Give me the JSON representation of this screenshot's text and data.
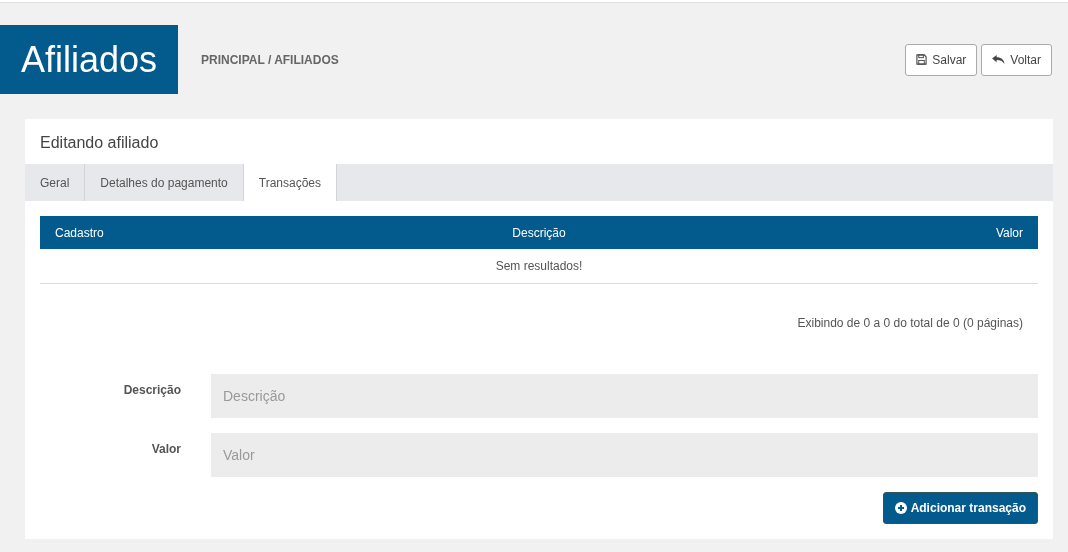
{
  "page_title": "Afiliados",
  "breadcrumb": {
    "items": [
      {
        "label": "PRINCIPAL"
      },
      {
        "label": "AFILIADOS"
      }
    ],
    "separator": "/"
  },
  "header_buttons": [
    {
      "label": "Salvar",
      "kind": "save"
    },
    {
      "label": "Voltar",
      "kind": "back"
    }
  ],
  "card_title": "Editando afiliado",
  "tabs": [
    {
      "label": "Geral",
      "selected": false
    },
    {
      "label": "Detalhes do pagamento",
      "selected": false
    },
    {
      "label": "Transações",
      "selected": true
    }
  ],
  "table": {
    "columns": [
      {
        "label": "Cadastro"
      },
      {
        "label": "Descrição"
      },
      {
        "label": "Valor"
      }
    ],
    "empty_message": "Sem resultados!"
  },
  "pagination_info": "Exibindo de 0 a 0 do total de 0 (0 páginas)",
  "form": [
    {
      "label": "Descrição",
      "placeholder": "Descrição"
    },
    {
      "label": "Valor",
      "placeholder": "Valor"
    }
  ],
  "submit_button": "Adicionar transação"
}
